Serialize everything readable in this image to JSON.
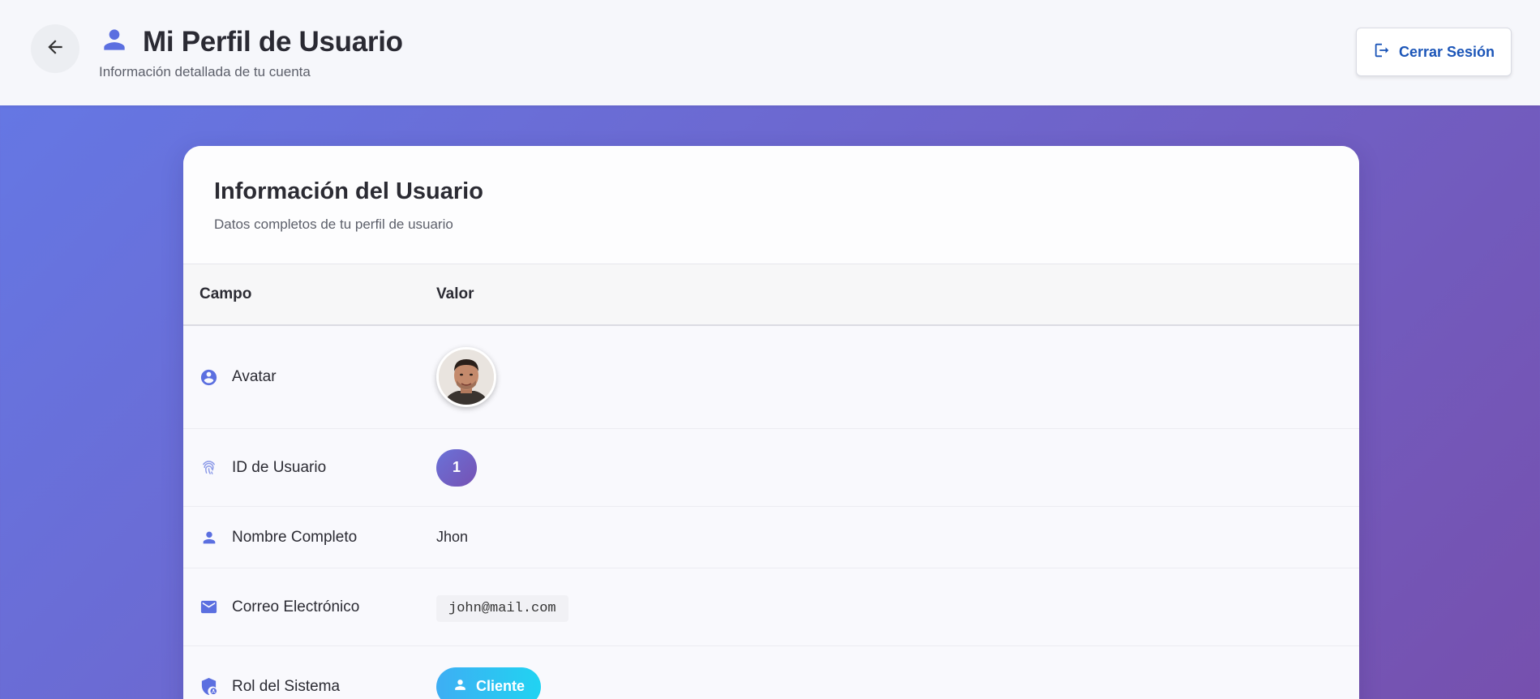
{
  "header": {
    "title": "Mi Perfil de Usuario",
    "subtitle": "Información detallada de tu cuenta",
    "logout_label": "Cerrar Sesión"
  },
  "card": {
    "title": "Información del Usuario",
    "subtitle": "Datos completos de tu perfil de usuario"
  },
  "table": {
    "columns": [
      "Campo",
      "Valor"
    ],
    "rows": [
      {
        "field": "Avatar",
        "icon": "account-circle-icon"
      },
      {
        "field": "ID de Usuario",
        "icon": "fingerprint-icon",
        "value": "1"
      },
      {
        "field": "Nombre Completo",
        "icon": "person-icon",
        "value": "Jhon"
      },
      {
        "field": "Correo Electrónico",
        "icon": "email-icon",
        "value": "john@mail.com"
      },
      {
        "field": "Rol del Sistema",
        "icon": "admin-shield-icon",
        "value": "Cliente"
      }
    ]
  },
  "colors": {
    "accent": "#5b6fe0",
    "logout_text": "#1b55b8",
    "gradient_start": "#6479e6",
    "gradient_end": "#7650ae"
  }
}
